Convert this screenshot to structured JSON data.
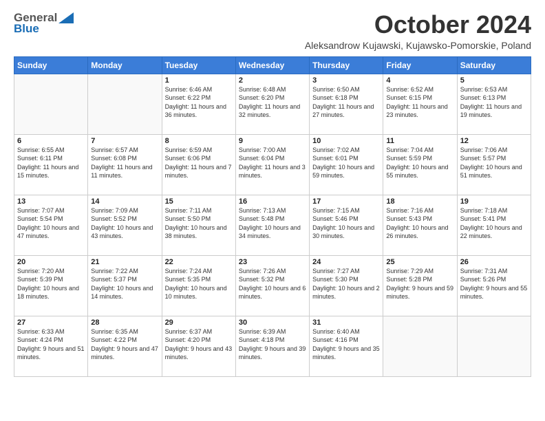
{
  "header": {
    "logo_general": "General",
    "logo_blue": "Blue",
    "title": "October 2024",
    "subtitle": "Aleksandrow Kujawski, Kujawsko-Pomorskie, Poland"
  },
  "days_of_week": [
    "Sunday",
    "Monday",
    "Tuesday",
    "Wednesday",
    "Thursday",
    "Friday",
    "Saturday"
  ],
  "weeks": [
    [
      {
        "day": "",
        "info": ""
      },
      {
        "day": "",
        "info": ""
      },
      {
        "day": "1",
        "info": "Sunrise: 6:46 AM\nSunset: 6:22 PM\nDaylight: 11 hours and 36 minutes."
      },
      {
        "day": "2",
        "info": "Sunrise: 6:48 AM\nSunset: 6:20 PM\nDaylight: 11 hours and 32 minutes."
      },
      {
        "day": "3",
        "info": "Sunrise: 6:50 AM\nSunset: 6:18 PM\nDaylight: 11 hours and 27 minutes."
      },
      {
        "day": "4",
        "info": "Sunrise: 6:52 AM\nSunset: 6:15 PM\nDaylight: 11 hours and 23 minutes."
      },
      {
        "day": "5",
        "info": "Sunrise: 6:53 AM\nSunset: 6:13 PM\nDaylight: 11 hours and 19 minutes."
      }
    ],
    [
      {
        "day": "6",
        "info": "Sunrise: 6:55 AM\nSunset: 6:11 PM\nDaylight: 11 hours and 15 minutes."
      },
      {
        "day": "7",
        "info": "Sunrise: 6:57 AM\nSunset: 6:08 PM\nDaylight: 11 hours and 11 minutes."
      },
      {
        "day": "8",
        "info": "Sunrise: 6:59 AM\nSunset: 6:06 PM\nDaylight: 11 hours and 7 minutes."
      },
      {
        "day": "9",
        "info": "Sunrise: 7:00 AM\nSunset: 6:04 PM\nDaylight: 11 hours and 3 minutes."
      },
      {
        "day": "10",
        "info": "Sunrise: 7:02 AM\nSunset: 6:01 PM\nDaylight: 10 hours and 59 minutes."
      },
      {
        "day": "11",
        "info": "Sunrise: 7:04 AM\nSunset: 5:59 PM\nDaylight: 10 hours and 55 minutes."
      },
      {
        "day": "12",
        "info": "Sunrise: 7:06 AM\nSunset: 5:57 PM\nDaylight: 10 hours and 51 minutes."
      }
    ],
    [
      {
        "day": "13",
        "info": "Sunrise: 7:07 AM\nSunset: 5:54 PM\nDaylight: 10 hours and 47 minutes."
      },
      {
        "day": "14",
        "info": "Sunrise: 7:09 AM\nSunset: 5:52 PM\nDaylight: 10 hours and 43 minutes."
      },
      {
        "day": "15",
        "info": "Sunrise: 7:11 AM\nSunset: 5:50 PM\nDaylight: 10 hours and 38 minutes."
      },
      {
        "day": "16",
        "info": "Sunrise: 7:13 AM\nSunset: 5:48 PM\nDaylight: 10 hours and 34 minutes."
      },
      {
        "day": "17",
        "info": "Sunrise: 7:15 AM\nSunset: 5:46 PM\nDaylight: 10 hours and 30 minutes."
      },
      {
        "day": "18",
        "info": "Sunrise: 7:16 AM\nSunset: 5:43 PM\nDaylight: 10 hours and 26 minutes."
      },
      {
        "day": "19",
        "info": "Sunrise: 7:18 AM\nSunset: 5:41 PM\nDaylight: 10 hours and 22 minutes."
      }
    ],
    [
      {
        "day": "20",
        "info": "Sunrise: 7:20 AM\nSunset: 5:39 PM\nDaylight: 10 hours and 18 minutes."
      },
      {
        "day": "21",
        "info": "Sunrise: 7:22 AM\nSunset: 5:37 PM\nDaylight: 10 hours and 14 minutes."
      },
      {
        "day": "22",
        "info": "Sunrise: 7:24 AM\nSunset: 5:35 PM\nDaylight: 10 hours and 10 minutes."
      },
      {
        "day": "23",
        "info": "Sunrise: 7:26 AM\nSunset: 5:32 PM\nDaylight: 10 hours and 6 minutes."
      },
      {
        "day": "24",
        "info": "Sunrise: 7:27 AM\nSunset: 5:30 PM\nDaylight: 10 hours and 2 minutes."
      },
      {
        "day": "25",
        "info": "Sunrise: 7:29 AM\nSunset: 5:28 PM\nDaylight: 9 hours and 59 minutes."
      },
      {
        "day": "26",
        "info": "Sunrise: 7:31 AM\nSunset: 5:26 PM\nDaylight: 9 hours and 55 minutes."
      }
    ],
    [
      {
        "day": "27",
        "info": "Sunrise: 6:33 AM\nSunset: 4:24 PM\nDaylight: 9 hours and 51 minutes."
      },
      {
        "day": "28",
        "info": "Sunrise: 6:35 AM\nSunset: 4:22 PM\nDaylight: 9 hours and 47 minutes."
      },
      {
        "day": "29",
        "info": "Sunrise: 6:37 AM\nSunset: 4:20 PM\nDaylight: 9 hours and 43 minutes."
      },
      {
        "day": "30",
        "info": "Sunrise: 6:39 AM\nSunset: 4:18 PM\nDaylight: 9 hours and 39 minutes."
      },
      {
        "day": "31",
        "info": "Sunrise: 6:40 AM\nSunset: 4:16 PM\nDaylight: 9 hours and 35 minutes."
      },
      {
        "day": "",
        "info": ""
      },
      {
        "day": "",
        "info": ""
      }
    ]
  ]
}
